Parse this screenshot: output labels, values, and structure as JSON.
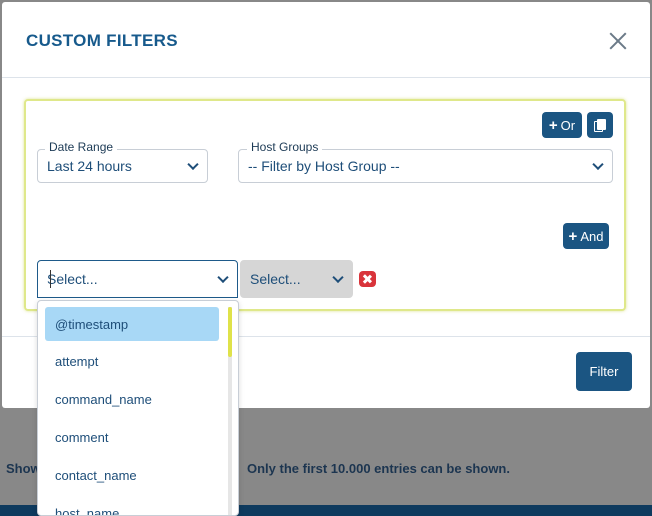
{
  "backdrop": {
    "left_text": "Show",
    "right_text": "Only the first 10.000 entries can be shown."
  },
  "modal": {
    "title": "CUSTOM FILTERS",
    "or_label": "Or",
    "and_label": "And",
    "filter_label": "Filter",
    "date_range": {
      "label": "Date Range",
      "value": "Last 24 hours"
    },
    "host_groups": {
      "label": "Host Groups",
      "value": "-- Filter by Host Group --"
    },
    "field_select": {
      "value": "Select..."
    },
    "operator_select": {
      "value": "Select..."
    },
    "dropdown": {
      "options": [
        "@timestamp",
        "attempt",
        "command_name",
        "comment",
        "contact_name",
        "host_name"
      ],
      "active_index": 0
    }
  },
  "colors": {
    "primary": "#1b5582",
    "highlight": "#a8d8f6",
    "box_border": "#dfe88a",
    "danger": "#d9343b"
  },
  "icons": [
    "close-icon",
    "plus-icon",
    "copy-icon",
    "chevron-down-icon",
    "remove-icon"
  ]
}
